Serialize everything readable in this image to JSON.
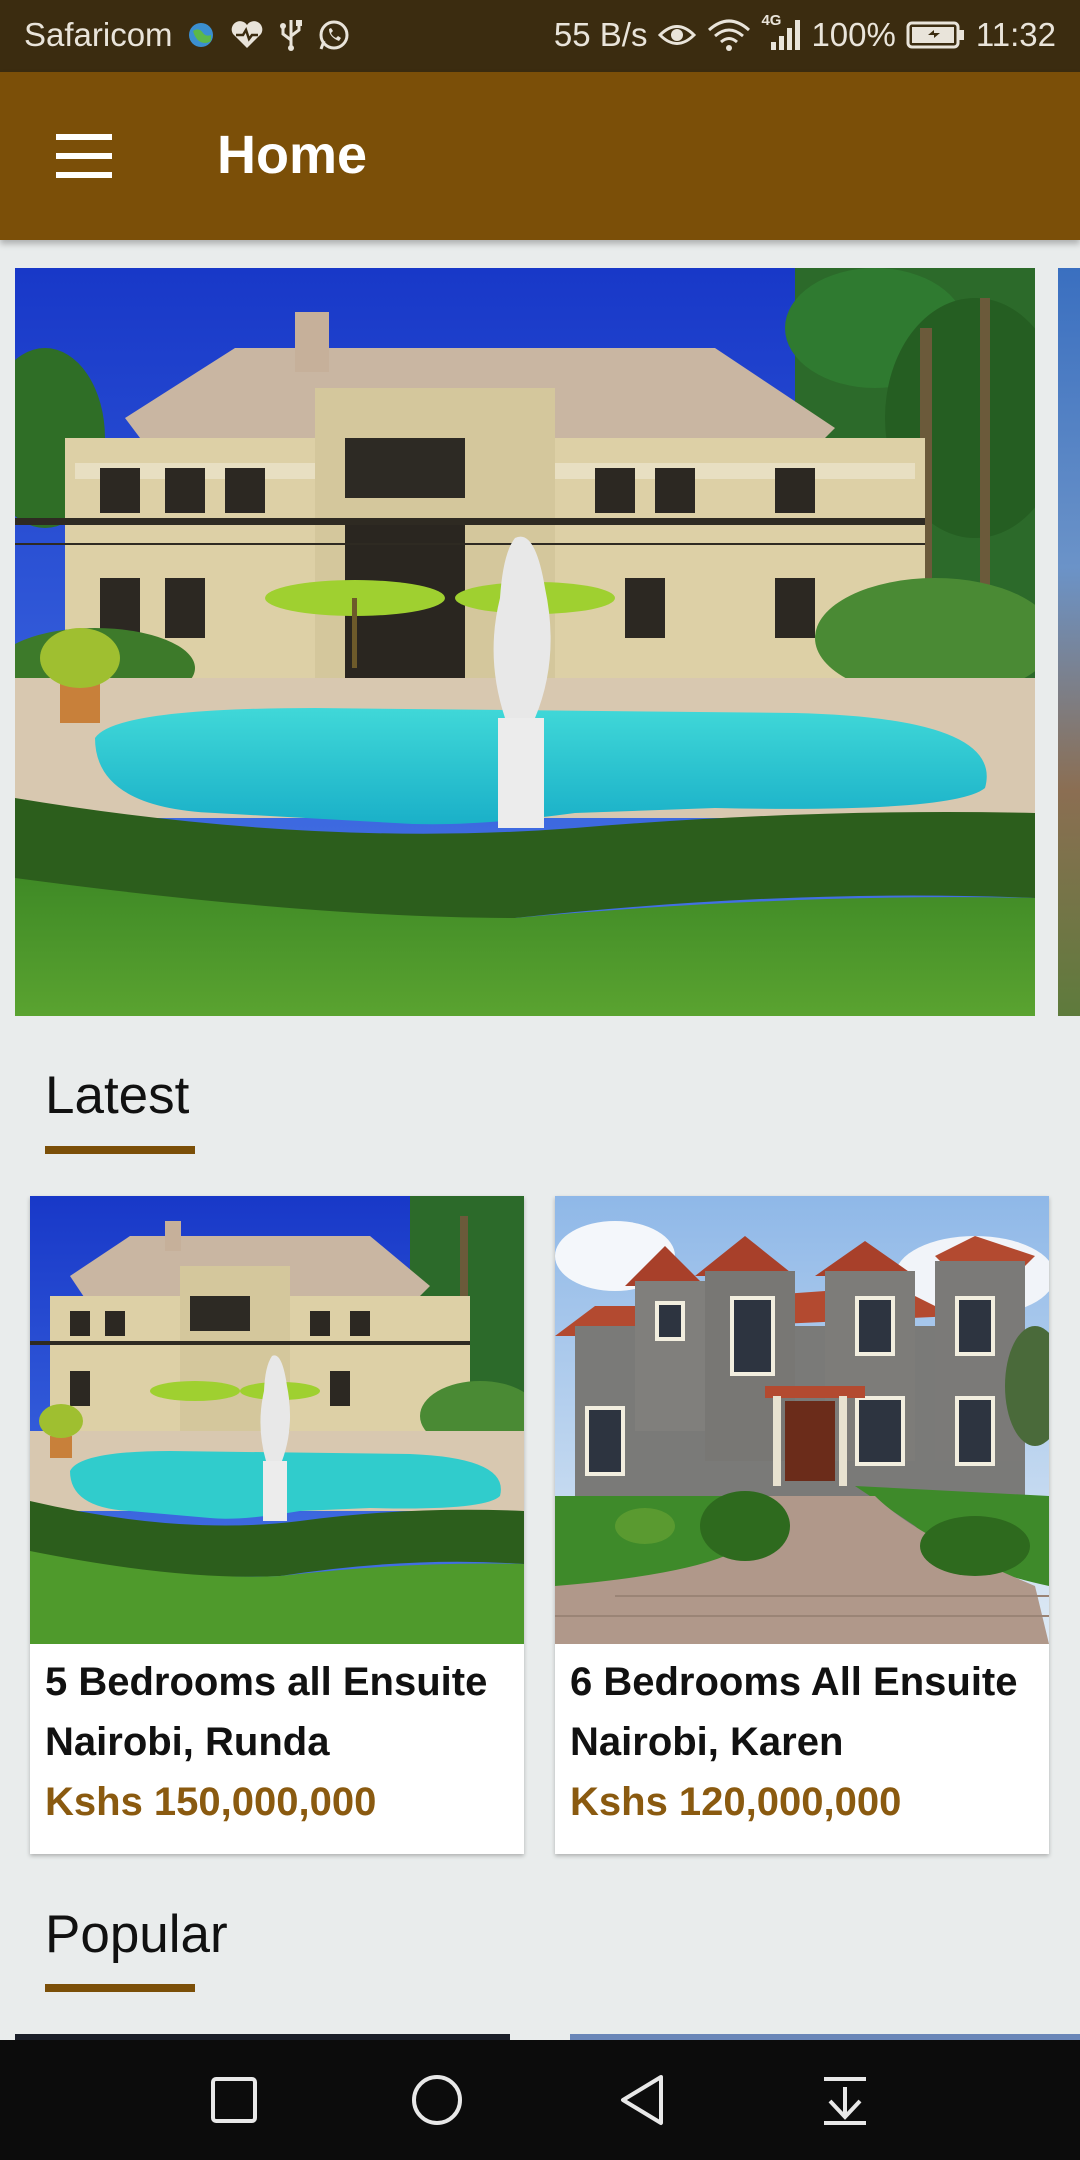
{
  "status_bar": {
    "carrier": "Safaricom",
    "speed": "55 B/s",
    "network": "4G",
    "battery": "100%",
    "time": "11:32"
  },
  "app_bar": {
    "title": "Home",
    "menu_icon": "hamburger-menu-icon"
  },
  "hero": {
    "image_alt": "Luxury mansion with swimming pool"
  },
  "sections": {
    "latest": "Latest",
    "popular": "Popular"
  },
  "listings": [
    {
      "title": "5 Bedrooms all Ensuite",
      "location": "Nairobi, Runda",
      "price": "Kshs 150,000,000"
    },
    {
      "title": "6 Bedrooms All Ensuite",
      "location": "Nairobi, Karen",
      "price": "Kshs 120,000,000"
    }
  ],
  "nav_bar": {
    "buttons": [
      "recents-icon",
      "home-icon",
      "back-icon",
      "notification-pulldown-icon"
    ]
  },
  "colors": {
    "status_bar": "#3b2c10",
    "app_bar": "#7b4f08",
    "accent": "#8a5a10",
    "background": "#e9ecec"
  }
}
